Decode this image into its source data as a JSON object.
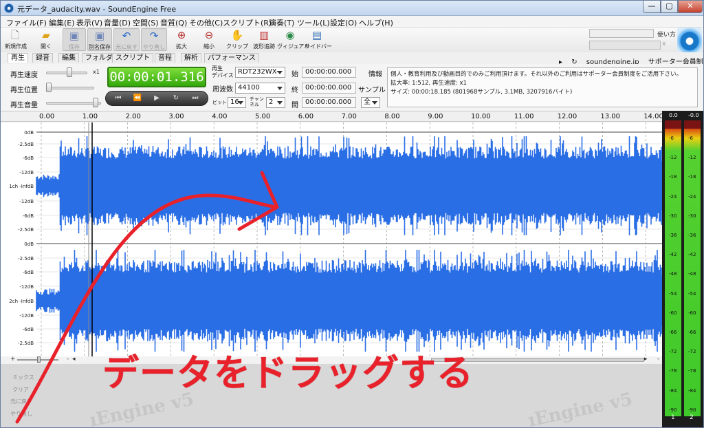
{
  "window": {
    "title": "元データ_audacity.wav - SoundEngine Free",
    "min": "—",
    "max": "▢",
    "close": "✕"
  },
  "menu": [
    "ファイル(F)",
    "編集(E)",
    "表示(V)",
    "音量(D)",
    "空間(S)",
    "音質(Q)",
    "その他(C)",
    "スクリプト(R)",
    "演奏(T)",
    "ツール(L)",
    "設定(O)",
    "ヘルプ(H)"
  ],
  "toolbar": {
    "new": "新規作成",
    "open": "開く",
    "save": "保存",
    "save_as": "別名保存",
    "undo": "元に戻す",
    "redo": "やり直し",
    "zoom_in": "拡大",
    "zoom_out": "縮小",
    "clip": "クリップ",
    "wave_follow": "波形追跡",
    "visual": "ヴィジュアル",
    "sidebar": "サイドバー",
    "howto": "使い方",
    "search_clear": "x"
  },
  "tabs": [
    "再生",
    "録音",
    "編集",
    "フォルダ",
    "スクリプト",
    "音程",
    "解析",
    "パフォーマンス"
  ],
  "site_links": {
    "link1": "soundengine.jp",
    "link2": "サポーター会員制度"
  },
  "playback": {
    "speed_label": "再生速度",
    "speed_value": "x1",
    "position_label": "再生位置",
    "volume_label": "再生音量",
    "time": "00:00:01.316",
    "device_label_1": "再生",
    "device_label_2": "デバイス",
    "device": "RDT232WX-",
    "freq_label": "周波数",
    "freq": "44100",
    "bit_label": "ビット",
    "bit": "16",
    "ch_label_1": "チャン",
    "ch_label_2": "ネル",
    "ch": "2",
    "start_label": "始",
    "start": "00:00:00.000",
    "end_label": "終",
    "end": "00:00:00.000",
    "len_label": "間",
    "len": "00:00:00.000",
    "info_label": "情報",
    "sample_label": "サンプル",
    "all": "全"
  },
  "info_panel": {
    "line1": "個人・教育利用及び動画目的でのみご利用頂けます。それ以外のご利用はサポーター会員制度をご活用下さい。",
    "line2": "拡大率: 1:512, 再生速度: x1",
    "line3": "サイズ: 00:00:18.185 (801968サンプル, 3.1MB, 3207916バイト)"
  },
  "ruler": [
    "0.00",
    "1.00",
    "2.00",
    "3.00",
    "4.00",
    "5.00",
    "6.00",
    "7.00",
    "8.00",
    "9.00",
    "10.00",
    "11.00",
    "12.00",
    "13.00",
    "14.00"
  ],
  "db_labels": [
    "0dB",
    "-2.5dB",
    "-6dB",
    "-12dB",
    "1ch -InfdB",
    "-12dB",
    "-6dB",
    "-2.5dB",
    "0dB",
    "-2.5dB",
    "-6dB",
    "-12dB",
    "2ch -InfdB",
    "-12dB",
    "-6dB",
    "-2.5dB"
  ],
  "side_buttons": [
    "ミックス",
    "クリア",
    "元に戻す",
    "やり直し"
  ],
  "watermark": {
    "w1": "ıEngine v5",
    "w2": "ıEngine v5"
  },
  "meter": {
    "head_left": "0.0",
    "head_right": "-0.0",
    "ch1": "1",
    "ch2": "2",
    "ticks": [
      "-6",
      "-12",
      "-18",
      "-24",
      "-30",
      "-36",
      "-42",
      "-48",
      "-54",
      "-60",
      "-66",
      "-72",
      "-78",
      "-84",
      "-90"
    ]
  },
  "overlay": {
    "caption": "データをドラッグする"
  },
  "colors": {
    "waveform": "#2a6ee6",
    "arrow": "#e8212b",
    "time_bg": "#4ec01c"
  }
}
